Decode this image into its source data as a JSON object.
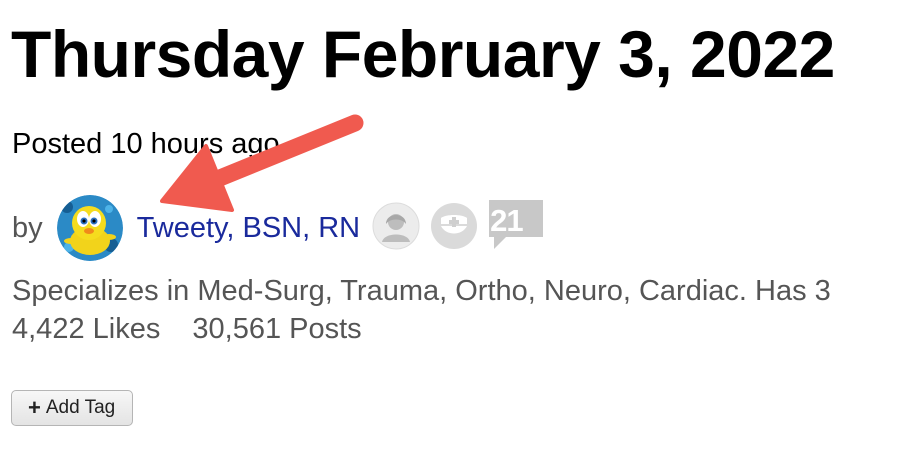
{
  "post": {
    "date_title": "Thursday February 3, 2022",
    "posted_text": "Posted 10 hours ago"
  },
  "author": {
    "by_label": "by",
    "name": "Tweety, BSN, RN",
    "years_badge": "21",
    "specialty": "Specializes in Med-Surg, Trauma, Ortho, Neuro, Cardiac. Has 3",
    "likes": "4,422 Likes",
    "posts": "30,561 Posts"
  },
  "actions": {
    "add_tag_label": "Add Tag"
  },
  "colors": {
    "link": "#1a2a9c",
    "muted_text": "#555555",
    "annotation_arrow": "#f05a4f"
  }
}
